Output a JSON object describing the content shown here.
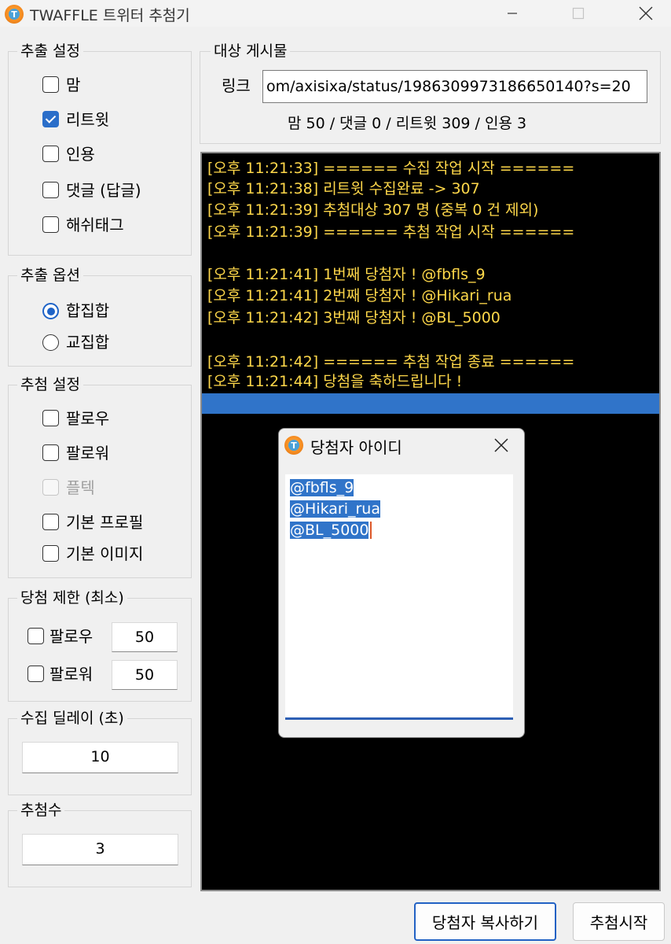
{
  "window": {
    "title": "TWAFFLE 트위터 추첨기",
    "logo_letter": "T",
    "minimize_icon": "minimize-icon",
    "maximize_icon": "maximize-icon",
    "close_icon": "close-icon"
  },
  "extract_settings": {
    "title": "추출 설정",
    "items": [
      {
        "label": "맘",
        "checked": false
      },
      {
        "label": "리트윗",
        "checked": true
      },
      {
        "label": "인용",
        "checked": false
      },
      {
        "label": "댓글 (답글)",
        "checked": false
      },
      {
        "label": "해쉬태그",
        "checked": false
      }
    ]
  },
  "extract_options": {
    "title": "추출 옵션",
    "items": [
      {
        "label": "합집합",
        "selected": true
      },
      {
        "label": "교집합",
        "selected": false
      }
    ]
  },
  "draw_settings": {
    "title": "추첨 설정",
    "items": [
      {
        "label": "팔로우",
        "checked": false,
        "enabled": true
      },
      {
        "label": "팔로워",
        "checked": false,
        "enabled": true
      },
      {
        "label": "플텍",
        "checked": false,
        "enabled": false
      },
      {
        "label": "기본 프로필",
        "checked": false,
        "enabled": true
      },
      {
        "label": "기본 이미지",
        "checked": false,
        "enabled": true
      }
    ]
  },
  "win_limit": {
    "title": "당첨 제한 (최소)",
    "items": [
      {
        "label": "팔로우",
        "checked": false,
        "value": "50"
      },
      {
        "label": "팔로워",
        "checked": false,
        "value": "50"
      }
    ]
  },
  "collect_delay": {
    "title": "수집 딜레이 (초)",
    "value": "10"
  },
  "draw_count": {
    "title": "추첨수",
    "value": "3"
  },
  "target_post": {
    "title": "대상 게시물",
    "link_label": "링크",
    "link_value": "om/axisixa/status/1986309973186650140?s=20",
    "stats": "맘 50 / 댓글 0 / 리트윗 309 / 인용 3"
  },
  "log": {
    "lines": [
      "[오후 11:21:33] ====== 수집 작업 시작 ======",
      "[오후 11:21:38] 리트윗 수집완료 -> 307",
      "[오후 11:21:39] 추첨대상 307 명 (중복 0 건 제외)",
      "[오후 11:21:39] ====== 추첨 작업 시작 ======",
      "",
      "[오후 11:21:41] 1번째 당첨자 ! @fbfls_9",
      "[오후 11:21:41] 2번째 당첨자 ! @Hikari_rua",
      "[오후 11:21:42] 3번째 당첨자 ! @BL_5000",
      "",
      "[오후 11:21:42] ====== 추첨 작업 종료 ======",
      "[오후 11:21:44] 당첨을 축하드립니다 !"
    ],
    "text_color": "#ffd84a",
    "highlight_color": "#3074c9"
  },
  "winners_dialog": {
    "title": "당첨자 아이디",
    "winners": [
      "@fbfls_9",
      "@Hikari_rua",
      "@BL_5000"
    ]
  },
  "buttons": {
    "copy_winners": "당첨자 복사하기",
    "start_draw": "추첨시작"
  }
}
